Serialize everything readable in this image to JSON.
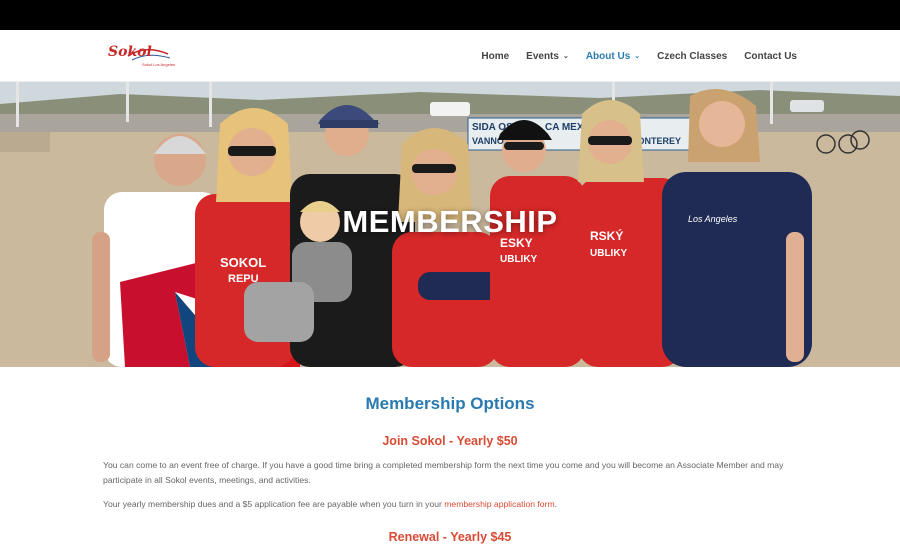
{
  "header": {
    "logo_text": "Sokol",
    "logo_subtext": "Sokol Los Angeles"
  },
  "nav": {
    "items": [
      {
        "label": "Home",
        "has_dropdown": false,
        "active": false
      },
      {
        "label": "Events",
        "has_dropdown": true,
        "active": false
      },
      {
        "label": "About Us",
        "has_dropdown": true,
        "active": true
      },
      {
        "label": "Czech Classes",
        "has_dropdown": false,
        "active": false
      },
      {
        "label": "Contact Us",
        "has_dropdown": false,
        "active": false
      }
    ]
  },
  "hero": {
    "title": "MEMBERSHIP",
    "sign_text_1": "SIDA OSO",
    "sign_text_2": "VANNOX",
    "sign_text_3": "CA MEXIC",
    "sign_text_4": "MONTEREY",
    "shirt_text_1": "SOKOL",
    "shirt_text_2": "REPU",
    "shirt_text_3": "ESKY",
    "shirt_text_4": "UBLIKY",
    "shirt_text_5": "RSKÝ",
    "shirt_text_6": "UBLIKY",
    "shirt_text_7": "Los Angeles"
  },
  "main": {
    "section_title": "Membership Options",
    "join_title": "Join Sokol - Yearly $50",
    "join_para_1": "You can come to an event free of charge. If you have a good time bring a completed membership form the next time you come and you will become an Associate Member and may participate in all Sokol events, meetings, and activities.",
    "join_para_2_prefix": "Your yearly membership dues and a $5 application fee are payable when you turn in your ",
    "join_para_2_link": "membership application form",
    "join_para_2_suffix": ".",
    "renewal_title": "Renewal - Yearly $45"
  },
  "colors": {
    "accent_blue": "#2a7ab0",
    "accent_red": "#d94b35",
    "top_bar": "#000000"
  }
}
